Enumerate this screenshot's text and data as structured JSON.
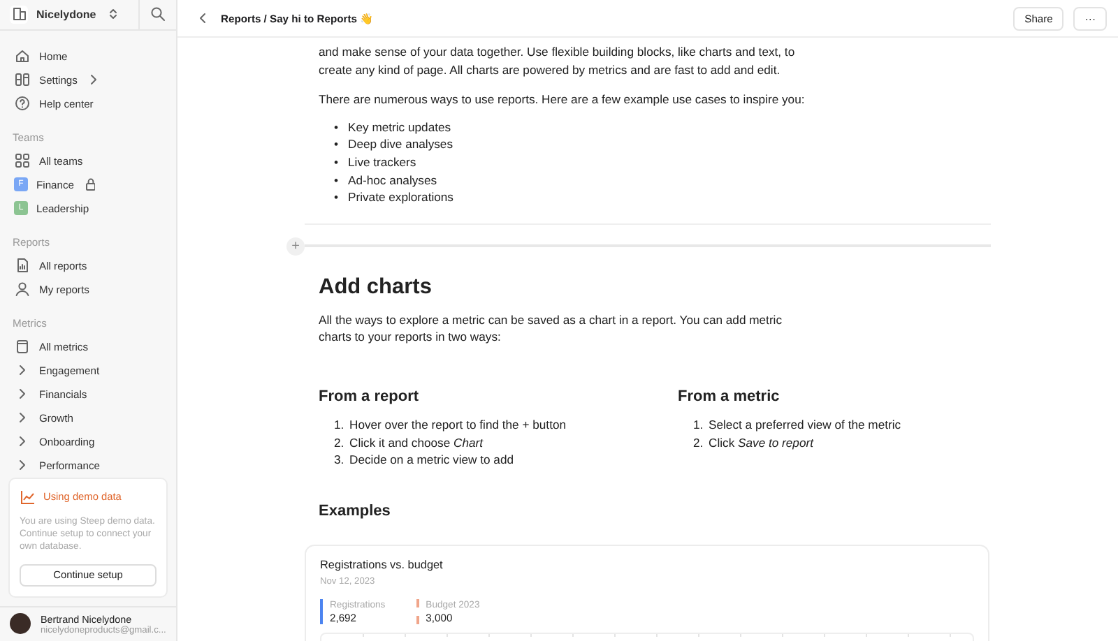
{
  "workspace": {
    "name": "Nicelydone"
  },
  "sidebar": {
    "items": [
      {
        "label": "Home",
        "kind": "link"
      },
      {
        "label": "Settings",
        "kind": "submenu"
      },
      {
        "label": "Help center",
        "kind": "link"
      }
    ],
    "sections": [
      {
        "title": "Teams",
        "items": [
          {
            "label": "All teams",
            "kind": "link"
          },
          {
            "label": "Finance",
            "kind": "team",
            "initial": "F",
            "color": "#7aa7f5",
            "locked": true
          },
          {
            "label": "Leadership",
            "kind": "team",
            "initial": "L",
            "color": "#8cc492",
            "locked": false
          }
        ]
      },
      {
        "title": "Reports",
        "items": [
          {
            "label": "All reports",
            "kind": "link"
          },
          {
            "label": "My reports",
            "kind": "link"
          }
        ]
      },
      {
        "title": "Metrics",
        "items": [
          {
            "label": "All metrics",
            "kind": "link"
          },
          {
            "label": "Engagement",
            "kind": "group",
            "expanded": false
          },
          {
            "label": "Financials",
            "kind": "group",
            "expanded": false
          },
          {
            "label": "Growth",
            "kind": "group",
            "expanded": false
          },
          {
            "label": "Onboarding",
            "kind": "group",
            "expanded": false
          },
          {
            "label": "Performance",
            "kind": "group",
            "expanded": false
          }
        ]
      }
    ],
    "demo_notice": {
      "title": "Using demo data",
      "text": "You are using Steep demo data. Continue setup to connect your own database.",
      "button": "Continue setup"
    },
    "user": {
      "name": "Bertrand Nicelydone",
      "email": "nicelydoneproducts@gmail.c..."
    }
  },
  "header": {
    "breadcrumb": "Reports / Say hi to Reports 👋",
    "share": "Share",
    "more": "···"
  },
  "document": {
    "intro": [
      "and make sense of your data together. Use flexible building blocks, like charts and text, to create any kind of page. All charts are powered by metrics and are fast to add and edit.",
      "There are numerous ways to use reports. Here are a few example use cases to inspire you:"
    ],
    "bullets": [
      {
        "marker": "•",
        "text": "Key metric updates"
      },
      {
        "marker": "•",
        "text": "Deep dive analyses"
      },
      {
        "marker": "•",
        "text": "Live trackers"
      },
      {
        "marker": "•",
        "text": "Ad-hoc analyses"
      },
      {
        "marker": "•",
        "text": "Private explorations"
      }
    ],
    "add_block": "+",
    "heading": "Add charts",
    "heading_text": "All the ways to explore a metric can be saved as a chart in a report. You can add metric charts to your reports in two ways:",
    "columns": [
      {
        "title": "From a report",
        "steps": [
          {
            "number": "1.",
            "text": "Hover over the report to find the + button"
          },
          {
            "number": "2.",
            "text": "Click it and choose *Chart*"
          },
          {
            "number": "3.",
            "text": "Decide on a metric view to add"
          }
        ]
      },
      {
        "title": "From a metric",
        "steps": [
          {
            "number": "1.",
            "text": "Select a preferred view of the metric"
          },
          {
            "number": "2.",
            "text": "Click *Save to report*"
          }
        ]
      }
    ],
    "examples_heading": "Examples",
    "example_card": {
      "title": "Registrations vs. budget",
      "date": "Nov 12, 2023",
      "legend": [
        {
          "label": "Registrations",
          "value": "2,692",
          "kind": "solid",
          "color": "#4c84f0"
        },
        {
          "label": "Budget 2023",
          "value": "3,000",
          "kind": "dashed",
          "color": "#f0a58a"
        }
      ]
    }
  }
}
